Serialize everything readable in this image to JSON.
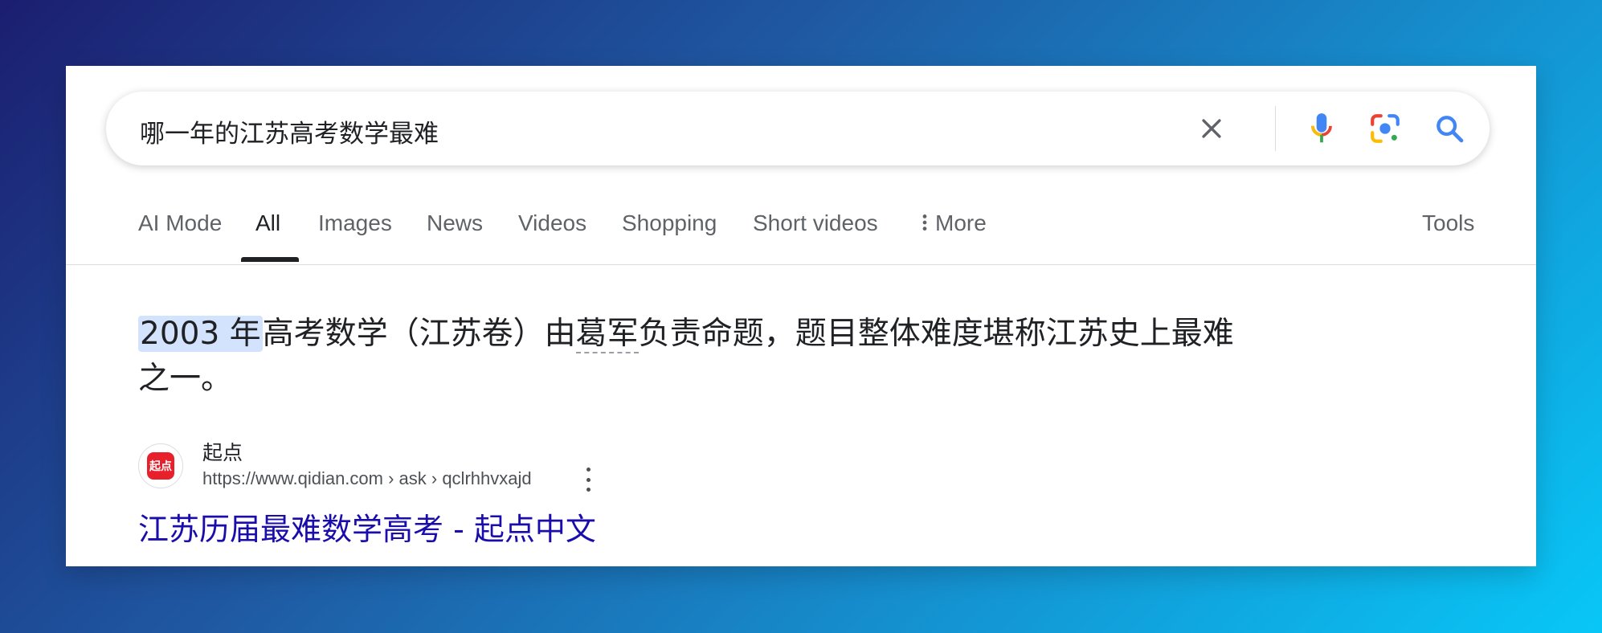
{
  "search": {
    "query": "哪一年的江苏高考数学最难",
    "clear_icon": "close-icon",
    "voice_icon": "microphone-icon",
    "lens_icon": "camera-lens-icon",
    "search_icon": "search-icon"
  },
  "tabs": [
    {
      "label": "AI Mode",
      "active": false
    },
    {
      "label": "All",
      "active": true
    },
    {
      "label": "Images",
      "active": false
    },
    {
      "label": "News",
      "active": false
    },
    {
      "label": "Videos",
      "active": false
    },
    {
      "label": "Shopping",
      "active": false
    },
    {
      "label": "Short videos",
      "active": false
    },
    {
      "label": "More",
      "active": false
    }
  ],
  "tools_label": "Tools",
  "answer": {
    "highlight": "2003 年",
    "part1": "高考数学（江苏卷）由",
    "dotted_term": "葛军",
    "part2": "负责命题，题目整体难度堪称江苏史上最难之一。"
  },
  "result": {
    "favicon_text": "起点",
    "site_name": "起点",
    "url": "https://www.qidian.com › ask › qclrhhvxajd",
    "title": "江苏历届最难数学高考 - 起点中文"
  },
  "colors": {
    "accent_blue": "#4285f4",
    "link": "#1a0dab",
    "highlight_bg": "#d3e3fd",
    "favicon_red": "#e8202c"
  }
}
